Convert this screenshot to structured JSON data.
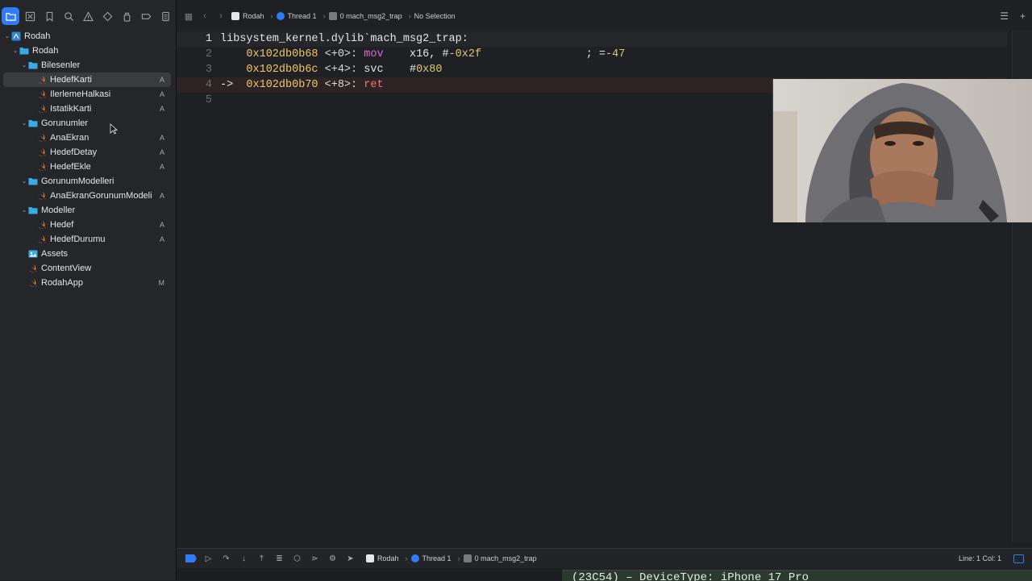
{
  "navigator": {
    "toolbar_icons": [
      "folder-icon",
      "x-square-icon",
      "bookmark-icon",
      "search-icon",
      "warning-icon",
      "diamond-icon",
      "spray-icon",
      "tag-icon",
      "report-icon"
    ],
    "tree": [
      {
        "label": "Rodah",
        "level": 0,
        "kind": "project",
        "expanded": true,
        "badge": ""
      },
      {
        "label": "Rodah",
        "level": 1,
        "kind": "folder",
        "expanded": true,
        "badge": ""
      },
      {
        "label": "Bilesenler",
        "level": 2,
        "kind": "folder",
        "expanded": true,
        "badge": ""
      },
      {
        "label": "HedefKarti",
        "level": 3,
        "kind": "swift",
        "selected": true,
        "badge": "A"
      },
      {
        "label": "IlerlemeHalkasi",
        "level": 3,
        "kind": "swift",
        "badge": "A"
      },
      {
        "label": "IstatikKarti",
        "level": 3,
        "kind": "swift",
        "badge": "A"
      },
      {
        "label": "Gorunumler",
        "level": 2,
        "kind": "folder",
        "expanded": true,
        "badge": ""
      },
      {
        "label": "AnaEkran",
        "level": 3,
        "kind": "swift",
        "badge": "A"
      },
      {
        "label": "HedefDetay",
        "level": 3,
        "kind": "swift",
        "badge": "A"
      },
      {
        "label": "HedefEkle",
        "level": 3,
        "kind": "swift",
        "badge": "A"
      },
      {
        "label": "GorunumModelleri",
        "level": 2,
        "kind": "folder",
        "expanded": true,
        "badge": ""
      },
      {
        "label": "AnaEkranGorunumModeli",
        "level": 3,
        "kind": "swift",
        "badge": "A"
      },
      {
        "label": "Modeller",
        "level": 2,
        "kind": "folder",
        "expanded": true,
        "badge": ""
      },
      {
        "label": "Hedef",
        "level": 3,
        "kind": "swift",
        "badge": "A"
      },
      {
        "label": "HedefDurumu",
        "level": 3,
        "kind": "swift",
        "badge": "A"
      },
      {
        "label": "Assets",
        "level": 2,
        "kind": "assets",
        "badge": ""
      },
      {
        "label": "ContentView",
        "level": 2,
        "kind": "swift",
        "badge": ""
      },
      {
        "label": "RodahApp",
        "level": 2,
        "kind": "swift",
        "badge": "M"
      }
    ]
  },
  "jumpbar": {
    "crumbs": [
      "Rodah",
      "Thread 1",
      "0 mach_msg2_trap",
      "No Selection"
    ]
  },
  "editor": {
    "lines": [
      {
        "n": "1",
        "parts": [
          {
            "t": "libsystem_kernel.dylib`mach_msg2_trap:",
            "c": "plain"
          }
        ],
        "highlight": true
      },
      {
        "n": "2",
        "parts": [
          {
            "t": "    ",
            "c": "plain"
          },
          {
            "t": "0x102db0b68",
            "c": "addr"
          },
          {
            "t": " <+0>: ",
            "c": "off"
          },
          {
            "t": "mov",
            "c": "kw"
          },
          {
            "t": "    x16, #",
            "c": "plain"
          },
          {
            "t": "-0x2f",
            "c": "num"
          },
          {
            "t": "                ; =",
            "c": "plain"
          },
          {
            "t": "-47",
            "c": "num"
          }
        ]
      },
      {
        "n": "3",
        "parts": [
          {
            "t": "    ",
            "c": "plain"
          },
          {
            "t": "0x102db0b6c",
            "c": "addr"
          },
          {
            "t": " <+4>: ",
            "c": "off"
          },
          {
            "t": "svc",
            "c": "plain"
          },
          {
            "t": "    #",
            "c": "plain"
          },
          {
            "t": "0x80",
            "c": "num"
          }
        ]
      },
      {
        "n": "4",
        "parts": [
          {
            "t": "->  ",
            "c": "plain"
          },
          {
            "t": "0x102db0b70",
            "c": "addr"
          },
          {
            "t": " <+8>: ",
            "c": "off"
          },
          {
            "t": "ret",
            "c": "red"
          }
        ],
        "stop": true
      },
      {
        "n": "5",
        "parts": []
      }
    ]
  },
  "debugbar": {
    "crumbs": [
      "Rodah",
      "Thread 1",
      "0 mach_msg2_trap"
    ],
    "position": "Line: 1  Col: 1"
  },
  "console": {
    "text": "(23C54) – DeviceType: iPhone 17 Pro"
  }
}
